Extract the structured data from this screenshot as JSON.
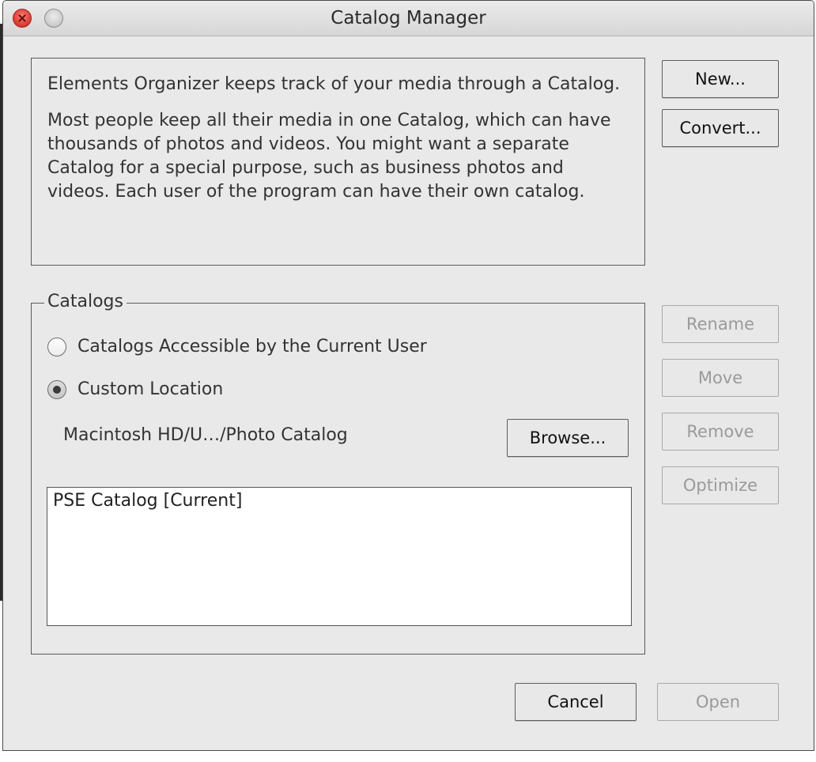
{
  "window": {
    "title": "Catalog Manager"
  },
  "info": {
    "paragraph1": "Elements Organizer keeps track of your media through a Catalog.",
    "paragraph2": "Most people keep all their media in one Catalog, which can have thousands of photos and videos. You might want a separate Catalog for a special purpose, such as business photos and videos. Each user of the program can have their own catalog."
  },
  "side_buttons": {
    "new": "New...",
    "convert": "Convert...",
    "rename": "Rename",
    "move": "Move",
    "remove": "Remove",
    "optimize": "Optimize"
  },
  "catalogs": {
    "legend": "Catalogs",
    "radio_options": [
      {
        "label": "Catalogs Accessible by the Current User",
        "selected": false
      },
      {
        "label": "Custom Location",
        "selected": true
      }
    ],
    "location_path": "Macintosh HD/U…/Photo Catalog",
    "browse_label": "Browse...",
    "list_items": [
      "PSE Catalog [Current]"
    ]
  },
  "footer": {
    "cancel": "Cancel",
    "open": "Open"
  },
  "icons": {
    "close": "close-icon",
    "minimize": "minimize-icon"
  }
}
